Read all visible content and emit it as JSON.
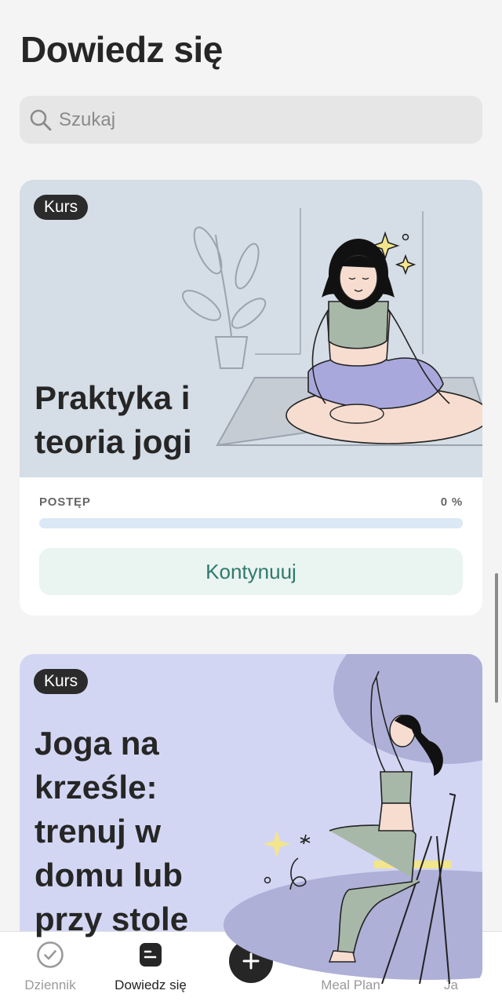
{
  "page": {
    "title": "Dowiedz się"
  },
  "search": {
    "placeholder": "Szukaj",
    "value": ""
  },
  "courses": [
    {
      "badge": "Kurs",
      "title": "Praktyka i teoria jogi",
      "progress_label": "POSTĘP",
      "progress_text": "0 %",
      "progress_fraction": 0,
      "button_label": "Kontynuuj"
    },
    {
      "badge": "Kurs",
      "title": "Joga na krześle: trenuj w domu lub przy stole"
    }
  ],
  "tabbar": {
    "items": [
      {
        "label": "Dziennik",
        "icon": "check-circle-icon",
        "active": false
      },
      {
        "label": "Dowiedz się",
        "icon": "learn-icon",
        "active": true
      },
      {
        "label": "",
        "icon": "plus-icon",
        "active": false
      },
      {
        "label": "Meal Plan",
        "icon": "bowl-icon",
        "active": false
      },
      {
        "label": "Ja",
        "icon": "profile-icon",
        "active": false
      }
    ]
  },
  "colors": {
    "accent": "#2f7a6c",
    "card1_bg": "#d5dde6",
    "card2_bg": "#d3d6f3"
  }
}
